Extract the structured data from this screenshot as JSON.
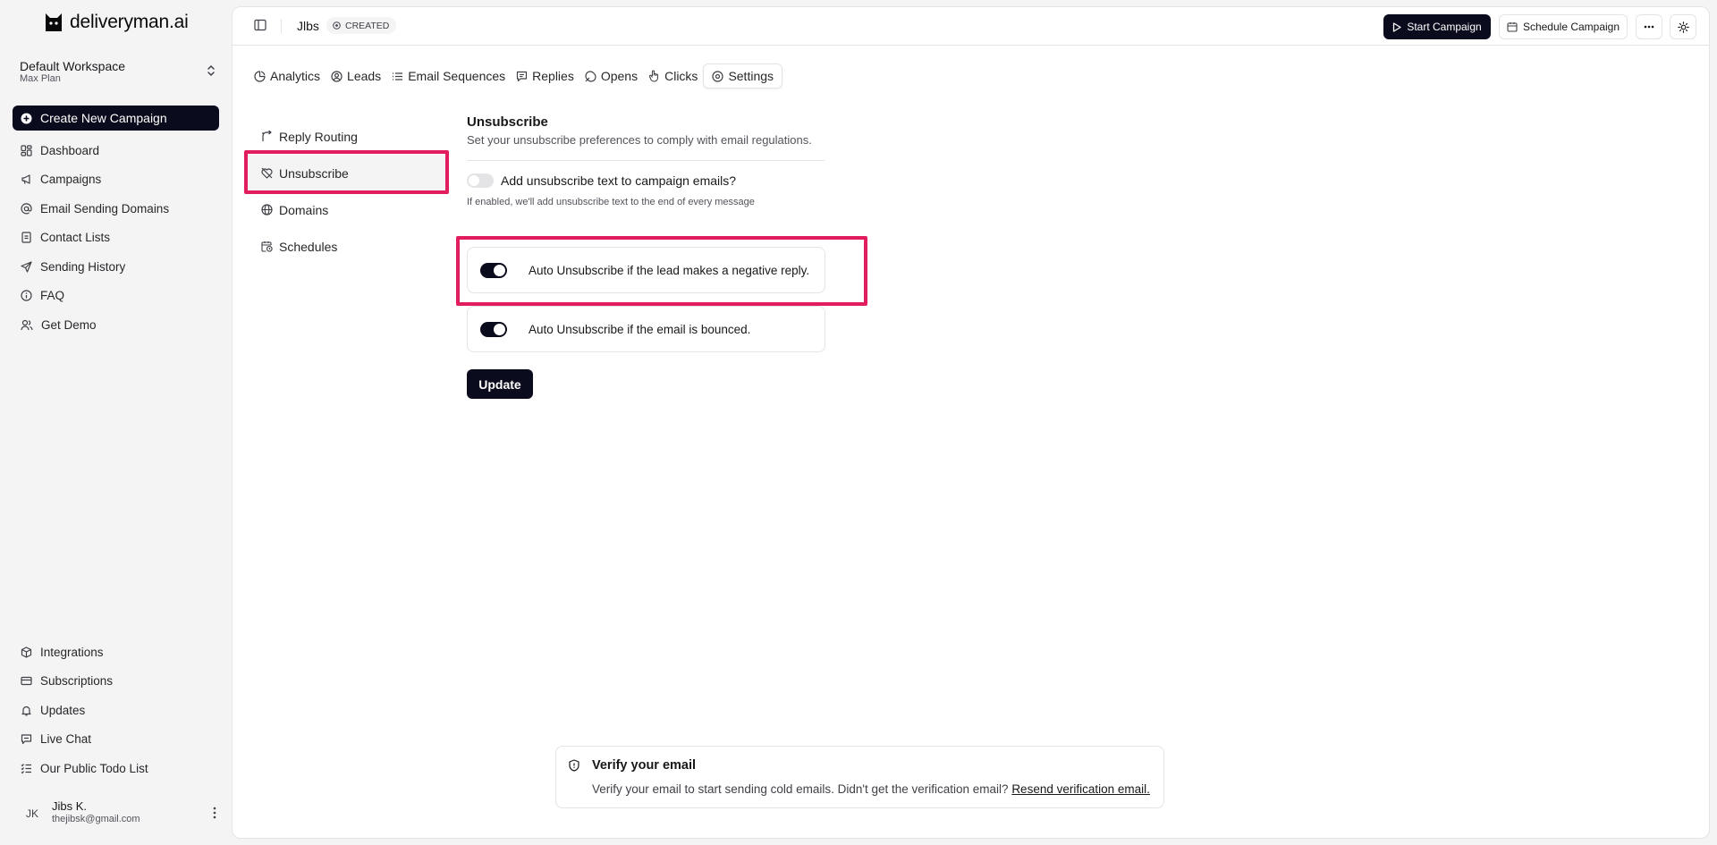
{
  "brand": {
    "name": "deliveryman.ai"
  },
  "workspace": {
    "name": "Default Workspace",
    "plan": "Max Plan"
  },
  "sidebar": {
    "create_label": "Create New Campaign",
    "items": [
      {
        "label": "Dashboard",
        "icon": "dashboard-icon"
      },
      {
        "label": "Campaigns",
        "icon": "megaphone-icon"
      },
      {
        "label": "Email Sending Domains",
        "icon": "at-sign-icon"
      },
      {
        "label": "Contact Lists",
        "icon": "contact-book-icon"
      },
      {
        "label": "Sending History",
        "icon": "send-icon"
      },
      {
        "label": "FAQ",
        "icon": "info-icon"
      },
      {
        "label": "Get Demo",
        "icon": "users-icon"
      }
    ],
    "bottom_items": [
      {
        "label": "Integrations",
        "icon": "package-icon"
      },
      {
        "label": "Subscriptions",
        "icon": "credit-card-icon"
      },
      {
        "label": "Updates",
        "icon": "bell-icon"
      },
      {
        "label": "Live Chat",
        "icon": "chat-icon"
      },
      {
        "label": "Our Public Todo List",
        "icon": "list-checks-icon"
      }
    ]
  },
  "user": {
    "initials": "JK",
    "name": "Jibs K.",
    "email": "thejibsk@gmail.com"
  },
  "header": {
    "campaign_name": "Jlbs",
    "status": "CREATED",
    "start_label": "Start Campaign",
    "schedule_label": "Schedule Campaign"
  },
  "tabs": [
    {
      "label": "Analytics",
      "icon": "pie-chart-icon"
    },
    {
      "label": "Leads",
      "icon": "user-circle-icon"
    },
    {
      "label": "Email Sequences",
      "icon": "sequence-icon"
    },
    {
      "label": "Replies",
      "icon": "message-icon"
    },
    {
      "label": "Opens",
      "icon": "open-icon"
    },
    {
      "label": "Clicks",
      "icon": "pointer-icon"
    },
    {
      "label": "Settings",
      "icon": "settings-icon",
      "active": true
    }
  ],
  "settings_nav": [
    {
      "label": "Reply Routing",
      "icon": "routing-icon"
    },
    {
      "label": "Unsubscribe",
      "icon": "unsubscribe-icon",
      "selected": true
    },
    {
      "label": "Domains",
      "icon": "globe-icon"
    },
    {
      "label": "Schedules",
      "icon": "calendar-clock-icon"
    }
  ],
  "unsubscribe": {
    "title": "Unsubscribe",
    "description": "Set your unsubscribe preferences to comply with email regulations.",
    "text_option_label": "Add unsubscribe text to campaign emails?",
    "text_option_enabled": false,
    "text_option_hint": "If enabled, we'll add unsubscribe text to the end of every message",
    "negative_reply_label": "Auto Unsubscribe if the lead makes a negative reply.",
    "negative_reply_enabled": true,
    "bounced_label": "Auto Unsubscribe if the email is bounced.",
    "bounced_enabled": true,
    "update_label": "Update"
  },
  "verify": {
    "title": "Verify your email",
    "text": "Verify your email to start sending cold emails. Didn't get the verification email?",
    "link": "Resend verification email."
  },
  "colors": {
    "primary": "#0b0b1e",
    "highlight": "#e11d5e",
    "border": "#e4e4e7",
    "sidebar_bg": "#f4f4f5"
  }
}
